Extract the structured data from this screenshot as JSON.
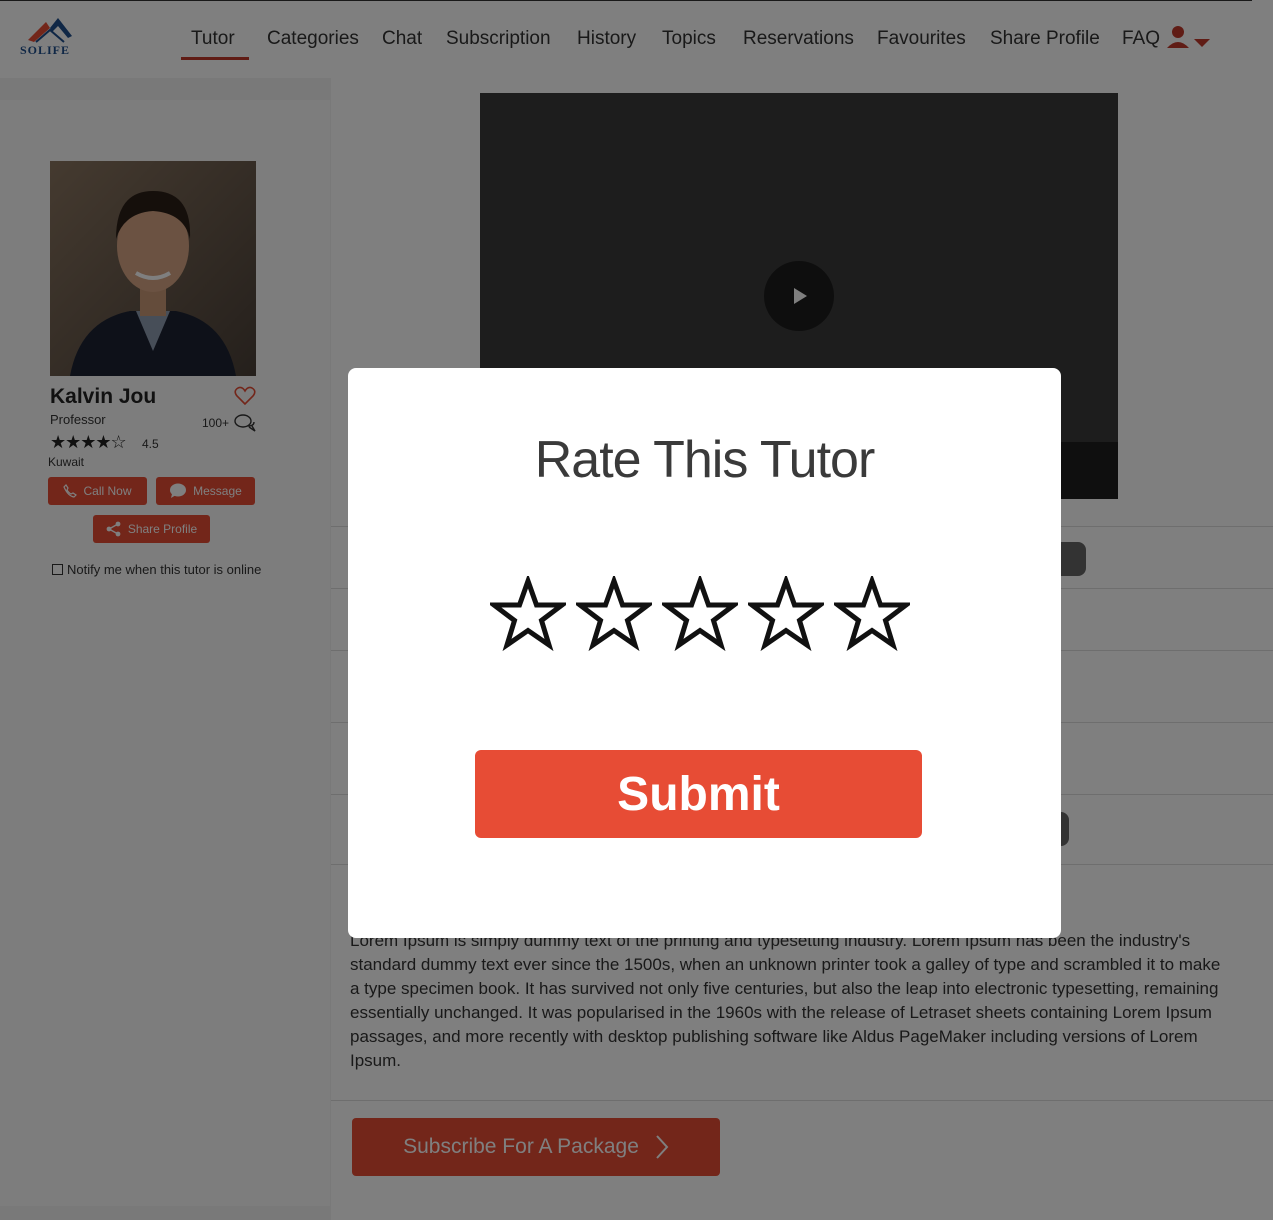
{
  "header": {
    "logo_text": "SOLIFE",
    "nav": [
      {
        "label": "Tutor",
        "active": true
      },
      {
        "label": "Categories"
      },
      {
        "label": "Chat"
      },
      {
        "label": "Subscription"
      },
      {
        "label": "History"
      },
      {
        "label": "Topics"
      },
      {
        "label": "Reservations"
      },
      {
        "label": "Favourites"
      },
      {
        "label": "Share Profile"
      },
      {
        "label": "FAQ"
      }
    ],
    "user_icon": "user-icon",
    "accent_color": "#c0392b"
  },
  "tutor": {
    "name": "Kalvin Jou",
    "title": "Professor",
    "rating_stars": "★★★★☆",
    "rating": "4.5",
    "reviews": "100+",
    "location": "Kuwait",
    "call_label": "Call Now",
    "message_label": "Message",
    "share_label": "Share Profile",
    "notify_label": "Notify me when this tutor is online"
  },
  "main": {
    "description": "Lorem Ipsum is simply dummy text of the printing and typesetting industry. Lorem Ipsum has been the industry's standard dummy text ever since the 1500s, when an unknown printer took a galley of type and scrambled it to make a type specimen book. It has survived not only five centuries, but also the leap into electronic typesetting, remaining essentially unchanged. It was popularised in the 1960s with the release of Letraset sheets containing Lorem Ipsum passages, and more recently with desktop publishing software like Aldus PageMaker including versions of Lorem Ipsum.",
    "subscribe_label": "Subscribe For A Package"
  },
  "modal": {
    "title": "Rate This Tutor",
    "star_count": 5,
    "selected_rating": 0,
    "submit_label": "Submit"
  },
  "colors": {
    "brand_red": "#e74c35",
    "overlay": "rgba(0,0,0,0.5)"
  }
}
